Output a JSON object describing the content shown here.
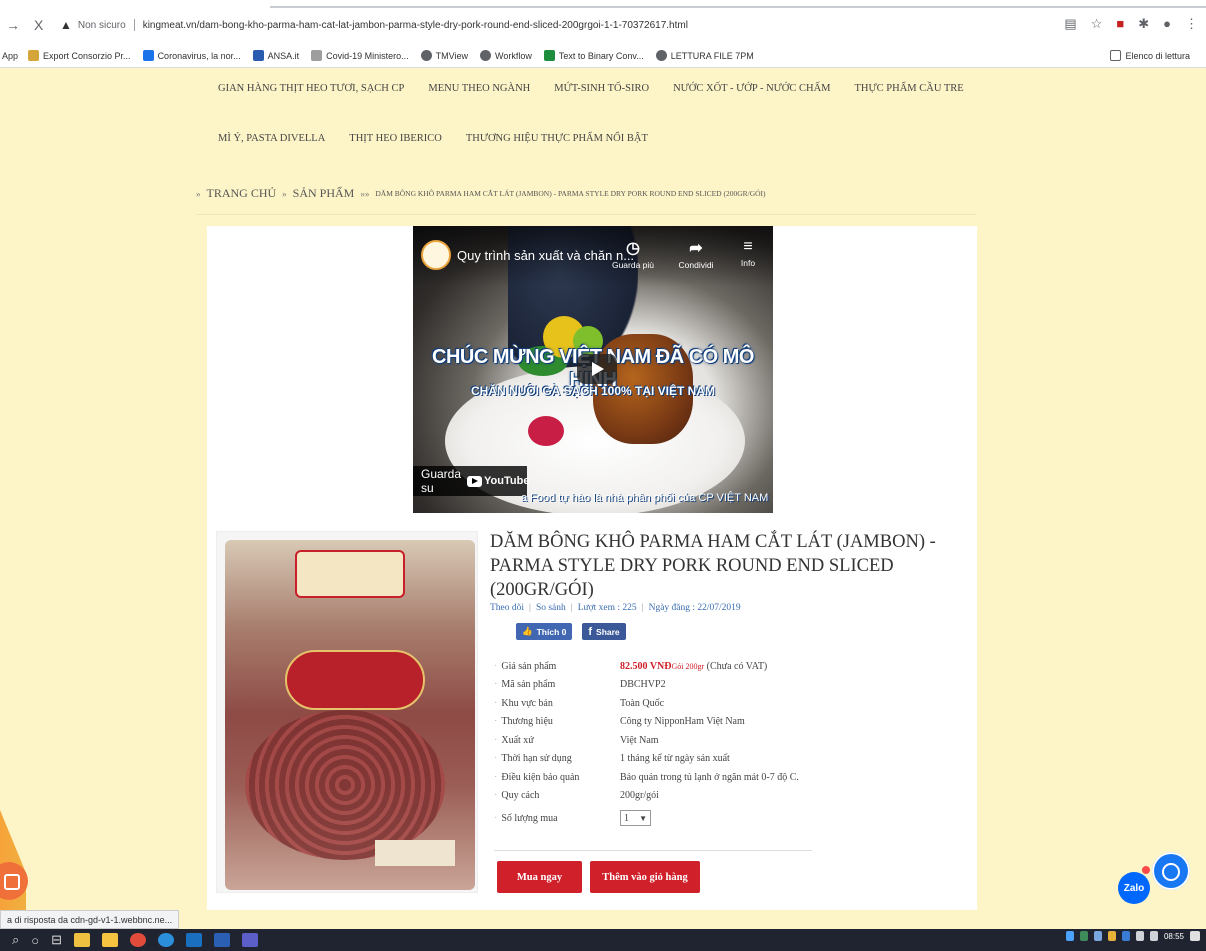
{
  "browser": {
    "back": "→",
    "close": "X",
    "security_label": "Non sicuro",
    "url": "kingmeat.vn/dam-bong-kho-parma-ham-cat-lat-jambon-parma-style-dry-pork-round-end-sliced-200grgoi-1-1-70372617.html"
  },
  "bookmarks": {
    "apps": "App",
    "items": [
      {
        "label": "Export Consorzio Pr...",
        "color": "#d4a63a"
      },
      {
        "label": "Coronavirus, la nor...",
        "color": "#1a73e8"
      },
      {
        "label": "ANSA.it",
        "color": "#2a5db0"
      },
      {
        "label": "Covid-19 Ministero...",
        "color": "#9e9e9e"
      },
      {
        "label": "TMView",
        "color": "#5f6368"
      },
      {
        "label": "Workflow",
        "color": "#5f6368"
      },
      {
        "label": "Text to Binary Conv...",
        "color": "#1e8e3e"
      },
      {
        "label": "LETTURA FILE 7PM",
        "color": "#5f6368"
      }
    ],
    "reading_list": "Elenco di lettura"
  },
  "site_nav": {
    "row1": [
      "GIAN HÀNG THỊT HEO TƯƠI, SẠCH CP",
      "MENU THEO NGÀNH",
      "MỨT-SINH TỐ-SIRO",
      "NƯỚC XỐT - ƯỚP - NƯỚC CHẤM",
      "THỰC PHẨM CẦU TRE"
    ],
    "row2": [
      "MÌ Ý, PASTA DIVELLA",
      "THỊT HEO IBERICO",
      "THƯƠNG HIỆU THỰC PHẨM NỔI BẬT"
    ]
  },
  "breadcrumb": {
    "home": "TRANG CHỦ",
    "products": "SẢN PHẨM",
    "current": "DĂM BÔNG KHÔ PARMA HAM CẮT LÁT (JAMBON) - PARMA STYLE DRY PORK ROUND END SLICED (200GR/GÓI)"
  },
  "video": {
    "title": "Quy trình sản xuất và chăn n...",
    "watch_later": "Guarda più",
    "share": "Condividi",
    "info": "Info",
    "headline": "CHÚC MỪNG VIỆT NAM ĐÃ CÓ MÔ HÌNH",
    "subheadline": "CHĂN NUÔI GÀ SẠCH 100% TẠI VIỆT NAM",
    "watch_on": "Guarda su",
    "youtube": "YouTube",
    "caption": "a Food tự hào là nhà phân phối của CP VIỆT NAM"
  },
  "product": {
    "title": "DĂM BÔNG KHÔ PARMA HAM CẮT LÁT (JAMBON) - PARMA STYLE DRY PORK ROUND END SLICED (200GR/GÓI)",
    "follow": "Theo dõi",
    "compare": "So sánh",
    "views": "Lượt xem : 225",
    "date": "Ngày đăng : 22/07/2019",
    "like_label": "Thích 0",
    "share_label": "Share",
    "specs": [
      {
        "key": "Giá sản phẩm",
        "value": ""
      },
      {
        "key": "Mã sản phẩm",
        "value": "DBCHVP2"
      },
      {
        "key": "Khu vực bán",
        "value": "Toàn Quốc"
      },
      {
        "key": "Thương hiệu",
        "value": "Công ty NipponHam Việt Nam"
      },
      {
        "key": "Xuất xứ",
        "value": "Việt Nam"
      },
      {
        "key": "Thời hạn sử dụng",
        "value": "1 tháng kể từ ngày sản xuất"
      },
      {
        "key": "Điều kiện bảo quản",
        "value": "Bảo quản trong tủ lạnh ở ngăn mát 0-7 độ C."
      },
      {
        "key": "Quy cách",
        "value": "200gr/gói"
      },
      {
        "key": "Số lượng mua",
        "value": ""
      }
    ],
    "price": "82.500 VNĐ",
    "price_unit": "Gói 200gr",
    "price_vat": "(Chưa có VAT)",
    "qty": "1",
    "buy_now": "Mua ngay",
    "add_cart": "Thêm vào giỏ hàng"
  },
  "widgets": {
    "zalo": "Zalo"
  },
  "status_tip": "a di risposta da cdn-gd-v1-1.webbnc.ne...",
  "clock": {
    "time": "08:55"
  }
}
